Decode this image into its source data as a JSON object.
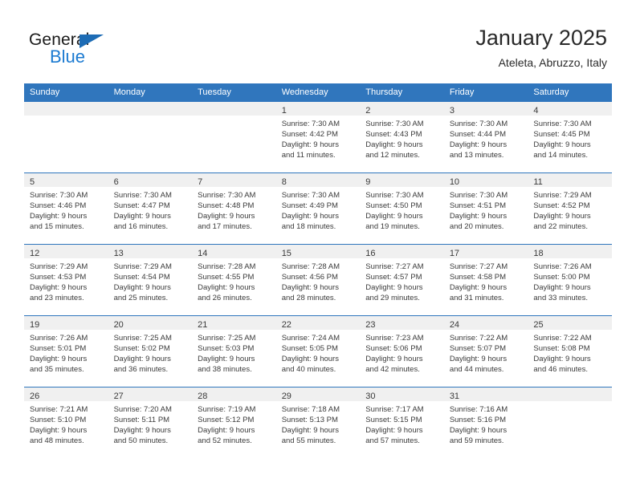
{
  "brand": {
    "name_top": "General",
    "name_bottom": "Blue",
    "triangle_icon": "triangle-icon",
    "accent_color": "#1b7ad1"
  },
  "header": {
    "title": "January 2025",
    "subtitle": "Ateleta, Abruzzo, Italy"
  },
  "theme": {
    "header_row_bg": "#3076bd",
    "daynum_band_bg": "#f0f0f0",
    "grid_line": "#3076bd",
    "text": "#3a3a3a"
  },
  "weekday_headers": [
    "Sunday",
    "Monday",
    "Tuesday",
    "Wednesday",
    "Thursday",
    "Friday",
    "Saturday"
  ],
  "weeks": [
    [
      {
        "day": "",
        "lines": []
      },
      {
        "day": "",
        "lines": []
      },
      {
        "day": "",
        "lines": []
      },
      {
        "day": "1",
        "lines": [
          "Sunrise: 7:30 AM",
          "Sunset: 4:42 PM",
          "Daylight: 9 hours",
          "and 11 minutes."
        ]
      },
      {
        "day": "2",
        "lines": [
          "Sunrise: 7:30 AM",
          "Sunset: 4:43 PM",
          "Daylight: 9 hours",
          "and 12 minutes."
        ]
      },
      {
        "day": "3",
        "lines": [
          "Sunrise: 7:30 AM",
          "Sunset: 4:44 PM",
          "Daylight: 9 hours",
          "and 13 minutes."
        ]
      },
      {
        "day": "4",
        "lines": [
          "Sunrise: 7:30 AM",
          "Sunset: 4:45 PM",
          "Daylight: 9 hours",
          "and 14 minutes."
        ]
      }
    ],
    [
      {
        "day": "5",
        "lines": [
          "Sunrise: 7:30 AM",
          "Sunset: 4:46 PM",
          "Daylight: 9 hours",
          "and 15 minutes."
        ]
      },
      {
        "day": "6",
        "lines": [
          "Sunrise: 7:30 AM",
          "Sunset: 4:47 PM",
          "Daylight: 9 hours",
          "and 16 minutes."
        ]
      },
      {
        "day": "7",
        "lines": [
          "Sunrise: 7:30 AM",
          "Sunset: 4:48 PM",
          "Daylight: 9 hours",
          "and 17 minutes."
        ]
      },
      {
        "day": "8",
        "lines": [
          "Sunrise: 7:30 AM",
          "Sunset: 4:49 PM",
          "Daylight: 9 hours",
          "and 18 minutes."
        ]
      },
      {
        "day": "9",
        "lines": [
          "Sunrise: 7:30 AM",
          "Sunset: 4:50 PM",
          "Daylight: 9 hours",
          "and 19 minutes."
        ]
      },
      {
        "day": "10",
        "lines": [
          "Sunrise: 7:30 AM",
          "Sunset: 4:51 PM",
          "Daylight: 9 hours",
          "and 20 minutes."
        ]
      },
      {
        "day": "11",
        "lines": [
          "Sunrise: 7:29 AM",
          "Sunset: 4:52 PM",
          "Daylight: 9 hours",
          "and 22 minutes."
        ]
      }
    ],
    [
      {
        "day": "12",
        "lines": [
          "Sunrise: 7:29 AM",
          "Sunset: 4:53 PM",
          "Daylight: 9 hours",
          "and 23 minutes."
        ]
      },
      {
        "day": "13",
        "lines": [
          "Sunrise: 7:29 AM",
          "Sunset: 4:54 PM",
          "Daylight: 9 hours",
          "and 25 minutes."
        ]
      },
      {
        "day": "14",
        "lines": [
          "Sunrise: 7:28 AM",
          "Sunset: 4:55 PM",
          "Daylight: 9 hours",
          "and 26 minutes."
        ]
      },
      {
        "day": "15",
        "lines": [
          "Sunrise: 7:28 AM",
          "Sunset: 4:56 PM",
          "Daylight: 9 hours",
          "and 28 minutes."
        ]
      },
      {
        "day": "16",
        "lines": [
          "Sunrise: 7:27 AM",
          "Sunset: 4:57 PM",
          "Daylight: 9 hours",
          "and 29 minutes."
        ]
      },
      {
        "day": "17",
        "lines": [
          "Sunrise: 7:27 AM",
          "Sunset: 4:58 PM",
          "Daylight: 9 hours",
          "and 31 minutes."
        ]
      },
      {
        "day": "18",
        "lines": [
          "Sunrise: 7:26 AM",
          "Sunset: 5:00 PM",
          "Daylight: 9 hours",
          "and 33 minutes."
        ]
      }
    ],
    [
      {
        "day": "19",
        "lines": [
          "Sunrise: 7:26 AM",
          "Sunset: 5:01 PM",
          "Daylight: 9 hours",
          "and 35 minutes."
        ]
      },
      {
        "day": "20",
        "lines": [
          "Sunrise: 7:25 AM",
          "Sunset: 5:02 PM",
          "Daylight: 9 hours",
          "and 36 minutes."
        ]
      },
      {
        "day": "21",
        "lines": [
          "Sunrise: 7:25 AM",
          "Sunset: 5:03 PM",
          "Daylight: 9 hours",
          "and 38 minutes."
        ]
      },
      {
        "day": "22",
        "lines": [
          "Sunrise: 7:24 AM",
          "Sunset: 5:05 PM",
          "Daylight: 9 hours",
          "and 40 minutes."
        ]
      },
      {
        "day": "23",
        "lines": [
          "Sunrise: 7:23 AM",
          "Sunset: 5:06 PM",
          "Daylight: 9 hours",
          "and 42 minutes."
        ]
      },
      {
        "day": "24",
        "lines": [
          "Sunrise: 7:22 AM",
          "Sunset: 5:07 PM",
          "Daylight: 9 hours",
          "and 44 minutes."
        ]
      },
      {
        "day": "25",
        "lines": [
          "Sunrise: 7:22 AM",
          "Sunset: 5:08 PM",
          "Daylight: 9 hours",
          "and 46 minutes."
        ]
      }
    ],
    [
      {
        "day": "26",
        "lines": [
          "Sunrise: 7:21 AM",
          "Sunset: 5:10 PM",
          "Daylight: 9 hours",
          "and 48 minutes."
        ]
      },
      {
        "day": "27",
        "lines": [
          "Sunrise: 7:20 AM",
          "Sunset: 5:11 PM",
          "Daylight: 9 hours",
          "and 50 minutes."
        ]
      },
      {
        "day": "28",
        "lines": [
          "Sunrise: 7:19 AM",
          "Sunset: 5:12 PM",
          "Daylight: 9 hours",
          "and 52 minutes."
        ]
      },
      {
        "day": "29",
        "lines": [
          "Sunrise: 7:18 AM",
          "Sunset: 5:13 PM",
          "Daylight: 9 hours",
          "and 55 minutes."
        ]
      },
      {
        "day": "30",
        "lines": [
          "Sunrise: 7:17 AM",
          "Sunset: 5:15 PM",
          "Daylight: 9 hours",
          "and 57 minutes."
        ]
      },
      {
        "day": "31",
        "lines": [
          "Sunrise: 7:16 AM",
          "Sunset: 5:16 PM",
          "Daylight: 9 hours",
          "and 59 minutes."
        ]
      },
      {
        "day": "",
        "lines": []
      }
    ]
  ]
}
